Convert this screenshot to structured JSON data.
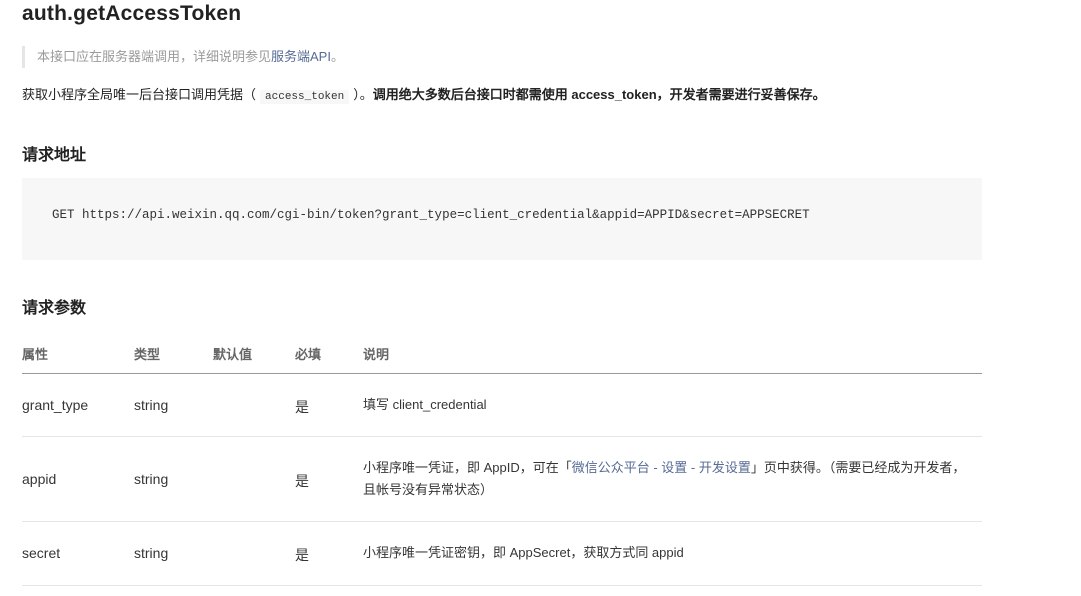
{
  "title": "auth.getAccessToken",
  "note": {
    "prefix": "本接口应在服务器端调用，详细说明参见",
    "link": "服务端API",
    "suffix": "。"
  },
  "description": {
    "part1": "获取小程序全局唯一后台接口调用凭据（",
    "code": "access_token",
    "part2": "）。",
    "bold": "调用绝大多数后台接口时都需使用 access_token，开发者需要进行妥善保存。"
  },
  "request_url_heading": "请求地址",
  "request_url": "GET https://api.weixin.qq.com/cgi-bin/token?grant_type=client_credential&appid=APPID&secret=APPSECRET",
  "params_heading": "请求参数",
  "table": {
    "headers": [
      "属性",
      "类型",
      "默认值",
      "必填",
      "说明"
    ],
    "rows": [
      {
        "name": "grant_type",
        "type": "string",
        "default": "",
        "required": "是",
        "desc": "填写 client_credential"
      },
      {
        "name": "appid",
        "type": "string",
        "default": "",
        "required": "是",
        "desc_prefix": "小程序唯一凭证，即 AppID，可在「",
        "desc_link": "微信公众平台 - 设置 - 开发设置",
        "desc_suffix": "」页中获得。（需要已经成为开发者，且帐号没有异常状态）"
      },
      {
        "name": "secret",
        "type": "string",
        "default": "",
        "required": "是",
        "desc": "小程序唯一凭证密钥，即 AppSecret，获取方式同 appid"
      }
    ]
  },
  "colors": {
    "link": "#576b95",
    "code_bg": "#f7f7f7",
    "border": "#e6e6e6"
  }
}
